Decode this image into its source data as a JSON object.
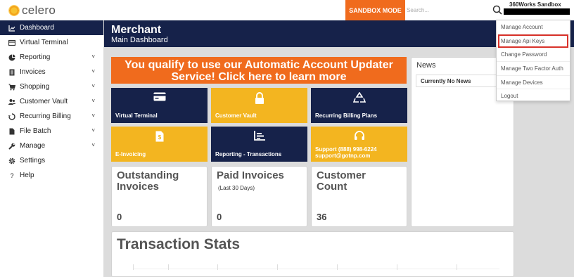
{
  "header": {
    "logo_text": "celero",
    "sandbox_label": "SANDBOX MODE",
    "search_placeholder": "Search...",
    "account_name": "360Works Sandbox"
  },
  "sidebar": {
    "items": [
      {
        "label": "Dashboard",
        "icon": "chart-line-icon",
        "active": true,
        "chevron": false
      },
      {
        "label": "Virtual Terminal",
        "icon": "terminal-icon",
        "active": false,
        "chevron": false
      },
      {
        "label": "Reporting",
        "icon": "pie-chart-icon",
        "active": false,
        "chevron": true
      },
      {
        "label": "Invoices",
        "icon": "file-text-icon",
        "active": false,
        "chevron": true
      },
      {
        "label": "Shopping",
        "icon": "shopping-cart-icon",
        "active": false,
        "chevron": true
      },
      {
        "label": "Customer Vault",
        "icon": "users-icon",
        "active": false,
        "chevron": true
      },
      {
        "label": "Recurring Billing",
        "icon": "recycle-icon",
        "active": false,
        "chevron": true
      },
      {
        "label": "File Batch",
        "icon": "file-icon",
        "active": false,
        "chevron": true
      },
      {
        "label": "Manage",
        "icon": "wrench-icon",
        "active": false,
        "chevron": true
      },
      {
        "label": "Settings",
        "icon": "gear-icon",
        "active": false,
        "chevron": false
      },
      {
        "label": "Help",
        "icon": "question-icon",
        "active": false,
        "chevron": false
      }
    ]
  },
  "page": {
    "title": "Merchant",
    "subtitle": "Main Dashboard"
  },
  "banner": {
    "text": "You qualify to use our Automatic Account Updater Service! Click here to learn more"
  },
  "tiles": [
    {
      "label": "Virtual Terminal",
      "icon": "credit-card-icon",
      "color": "navy"
    },
    {
      "label": "Customer Vault",
      "icon": "lock-icon",
      "color": "gold"
    },
    {
      "label": "Recurring Billing Plans",
      "icon": "recycle-icon",
      "color": "navy"
    },
    {
      "label": "E-Invoicing",
      "icon": "invoice-icon",
      "color": "gold"
    },
    {
      "label": "Reporting - Transactions",
      "icon": "bar-chart-icon",
      "color": "navy"
    },
    {
      "label": "Support (888) 998-6224",
      "label2": "support@gotnp.com",
      "icon": "headset-icon",
      "color": "gold"
    }
  ],
  "stats": [
    {
      "title": "Outstanding Invoices",
      "sub": "",
      "value": "0"
    },
    {
      "title": "Paid Invoices",
      "sub": "(Last 30 Days)",
      "value": "0"
    },
    {
      "title": "Customer Count",
      "sub": "",
      "value": "36"
    }
  ],
  "news": {
    "title": "News",
    "message": "Currently No News"
  },
  "transaction_stats": {
    "title": "Transaction Stats"
  },
  "account_menu": {
    "items": [
      {
        "label": "Manage Account",
        "highlight": false
      },
      {
        "label": "Manage Api Keys",
        "highlight": true
      },
      {
        "label": "Change Password",
        "highlight": false
      },
      {
        "label": "Manage Two Factor Auth",
        "highlight": false
      },
      {
        "label": "Manage Devices",
        "highlight": false
      },
      {
        "label": "Logout",
        "highlight": false
      }
    ]
  },
  "colors": {
    "navy": "#16224a",
    "orange": "#f06b1d",
    "gold": "#f3b520",
    "highlight_red": "#d9322a"
  }
}
